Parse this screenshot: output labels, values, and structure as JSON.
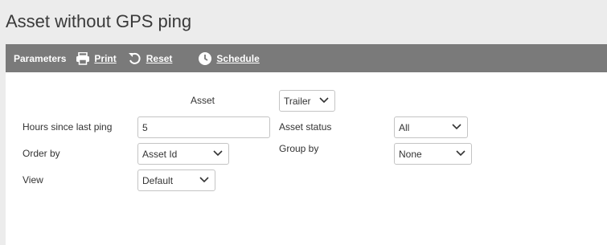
{
  "page": {
    "title": "Asset without GPS ping"
  },
  "toolbar": {
    "parameters_label": "Parameters",
    "print_label": "Print",
    "reset_label": "Reset",
    "schedule_label": "Schedule",
    "icons": {
      "print": "printer-icon",
      "reset": "reset-icon",
      "schedule": "clock-icon"
    }
  },
  "form": {
    "asset": {
      "label": "Asset",
      "value": "Trailer"
    },
    "hours_since_last_ping": {
      "label": "Hours since last ping",
      "value": "5"
    },
    "asset_status": {
      "label": "Asset status",
      "value": "All"
    },
    "order_by": {
      "label": "Order by",
      "value": "Asset Id"
    },
    "group_by": {
      "label": "Group by",
      "value": "None"
    },
    "view": {
      "label": "View",
      "value": "Default"
    }
  },
  "colors": {
    "toolbar_bg": "#7a7a7a",
    "page_bg": "#ececec",
    "panel_bg": "#ffffff"
  }
}
